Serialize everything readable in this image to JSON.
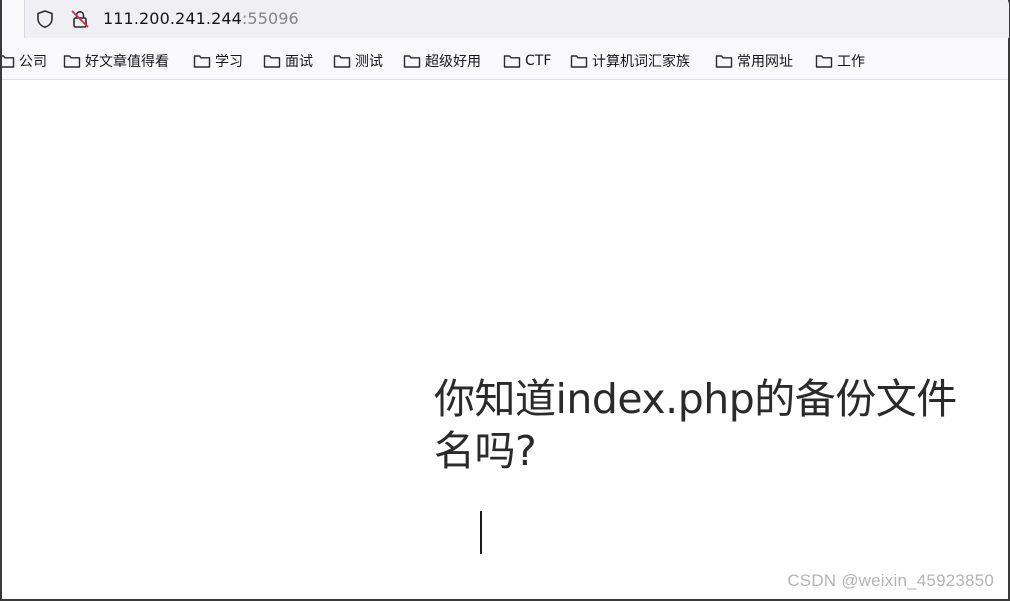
{
  "address_bar": {
    "host": "111.200.241.244",
    "port": ":55096",
    "icons": [
      "shield-icon",
      "insecure-connection-icon"
    ]
  },
  "bookmarks": [
    {
      "label": "公司",
      "icon": "folder-icon"
    },
    {
      "label": "好文章值得看",
      "icon": "folder-icon"
    },
    {
      "label": "学习",
      "icon": "folder-icon"
    },
    {
      "label": "面试",
      "icon": "folder-icon"
    },
    {
      "label": "测试",
      "icon": "folder-icon"
    },
    {
      "label": "超级好用",
      "icon": "folder-icon"
    },
    {
      "label": "CTF",
      "icon": "folder-icon"
    },
    {
      "label": "计算机词汇家族",
      "icon": "folder-icon"
    },
    {
      "label": "常用网址",
      "icon": "folder-icon"
    },
    {
      "label": "工作",
      "icon": "folder-icon"
    }
  ],
  "page": {
    "question": "你知道index.php的备份文件名吗?"
  },
  "watermark": "CSDN @weixin_45923850",
  "colors": {
    "toolbar_bg": "#f9f9fb",
    "urlbar_bg": "#f0f0f4",
    "port_text": "#85848a",
    "insecure_slash": "#e22850",
    "watermark_text": "#b4b4b4"
  }
}
